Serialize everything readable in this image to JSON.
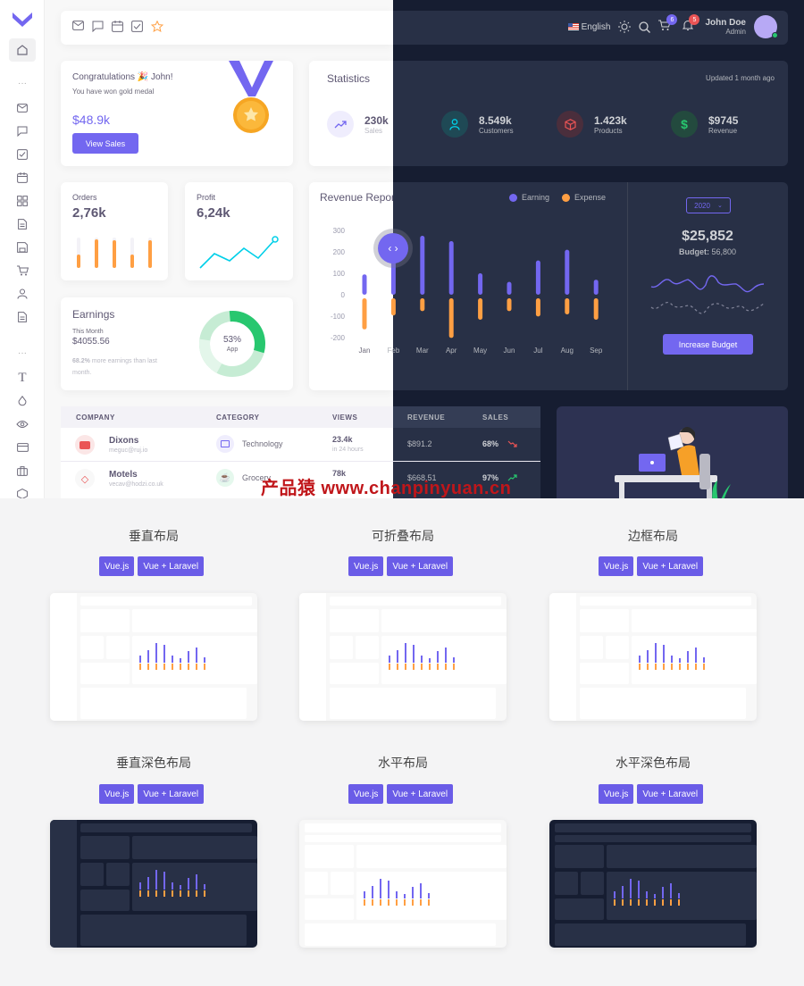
{
  "navbar": {
    "language": "English",
    "cart_count": "6",
    "notification_count": "5",
    "user_name": "John Doe",
    "user_role": "Admin"
  },
  "congrats": {
    "title": "Congratulations 🎉 John!",
    "subtitle": "You have won gold medal",
    "amount": "$48.9k",
    "button": "View Sales"
  },
  "statistics": {
    "title": "Statistics",
    "updated": "Updated 1 month ago",
    "items": [
      {
        "value": "230k",
        "label": "Sales",
        "icon": "trending-up-icon",
        "color": "#7367f0"
      },
      {
        "value": "8.549k",
        "label": "Customers",
        "icon": "user-icon",
        "color": "#00cfe8"
      },
      {
        "value": "1.423k",
        "label": "Products",
        "icon": "box-icon",
        "color": "#ea5455"
      },
      {
        "value": "$9745",
        "label": "Revenue",
        "icon": "dollar-icon",
        "color": "#28c76f"
      }
    ]
  },
  "orders": {
    "label": "Orders",
    "value": "2,76k"
  },
  "profit": {
    "label": "Profit",
    "value": "6,24k"
  },
  "earnings": {
    "title": "Earnings",
    "period": "This Month",
    "amount": "$4055.56",
    "note_pct": "68.2%",
    "note": "more earnings than last month.",
    "donut_pct": "53%",
    "donut_label": "App"
  },
  "revenue": {
    "title": "Revenue Report",
    "legend_earning": "Earning",
    "legend_expense": "Expense",
    "year": "2020",
    "total": "$25,852",
    "budget_label": "Budget:",
    "budget_value": "56,800",
    "button": "Increase Budget"
  },
  "chart_data": {
    "type": "bar",
    "title": "Revenue Report",
    "categories": [
      "Jan",
      "Feb",
      "Mar",
      "Apr",
      "May",
      "Jun",
      "Jul",
      "Aug",
      "Sep"
    ],
    "series": [
      {
        "name": "Earning",
        "values": [
          95,
          175,
          275,
          250,
          100,
          60,
          160,
          210,
          70
        ]
      },
      {
        "name": "Expense",
        "values": [
          -145,
          -80,
          -60,
          -185,
          -100,
          -60,
          -85,
          -75,
          -100
        ]
      }
    ],
    "yticks": [
      "300",
      "200",
      "100",
      "0",
      "-100",
      "-200"
    ],
    "ylim": [
      -200,
      300
    ]
  },
  "table": {
    "headers": [
      "COMPANY",
      "CATEGORY",
      "VIEWS",
      "REVENUE",
      "SALES"
    ],
    "rows": [
      {
        "company": "Dixons",
        "email": "meguc@ruj.io",
        "category": "Technology",
        "views": "23.4k",
        "views_sub": "in 24 hours",
        "revenue": "$891.2",
        "sales": "68%",
        "trend": "down"
      },
      {
        "company": "Motels",
        "email": "vecav@hodzi.co.uk",
        "category": "Grocery",
        "views": "78k",
        "views_sub": "",
        "revenue": "$668.51",
        "sales": "97%",
        "trend": "up"
      }
    ]
  },
  "watermark": "产品猿 www.chanpinyuan.cn",
  "layouts": [
    {
      "title": "垂直布局",
      "btn1": "Vue.js",
      "btn2": "Vue + Laravel",
      "theme": "light"
    },
    {
      "title": "可折叠布局",
      "btn1": "Vue.js",
      "btn2": "Vue + Laravel",
      "theme": "light"
    },
    {
      "title": "边框布局",
      "btn1": "Vue.js",
      "btn2": "Vue + Laravel",
      "theme": "light"
    },
    {
      "title": "垂直深色布局",
      "btn1": "Vue.js",
      "btn2": "Vue + Laravel",
      "theme": "dark"
    },
    {
      "title": "水平布局",
      "btn1": "Vue.js",
      "btn2": "Vue + Laravel",
      "theme": "light"
    },
    {
      "title": "水平深色布局",
      "btn1": "Vue.js",
      "btn2": "Vue + Laravel",
      "theme": "dark"
    }
  ]
}
